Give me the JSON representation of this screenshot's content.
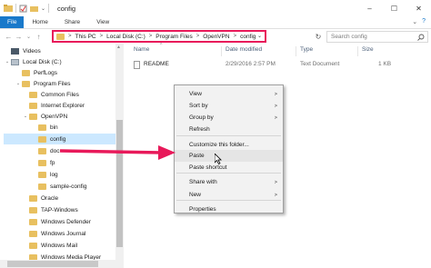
{
  "window": {
    "title": "config",
    "controls": [
      "–",
      "☐",
      "✕"
    ]
  },
  "ribbon": {
    "tabs": [
      "File",
      "Home",
      "Share",
      "View"
    ],
    "expand": "⌄",
    "help": "?"
  },
  "nav_buttons": [
    "←",
    "→",
    "⌄",
    "↑"
  ],
  "address": {
    "crumbs": [
      "This PC",
      "Local Disk (C:)",
      "Program Files",
      "OpenVPN",
      "config"
    ],
    "separator": ">",
    "dropdown": "⌄"
  },
  "search": {
    "placeholder": "Search config"
  },
  "refresh": "↻",
  "tree": [
    {
      "label": "Videos",
      "icon": "video-icon",
      "chev": ""
    },
    {
      "label": "Local Disk (C:)",
      "icon": "drive-icon",
      "chev": "⌄"
    },
    {
      "label": "PerfLogs",
      "icon": "folder-icon",
      "chev": ""
    },
    {
      "label": "Program Files",
      "icon": "folder-icon",
      "chev": "⌄"
    },
    {
      "label": "Common Files",
      "icon": "folder-icon",
      "chev": ""
    },
    {
      "label": "Internet Explorer",
      "icon": "folder-icon",
      "chev": ""
    },
    {
      "label": "OpenVPN",
      "icon": "folder-icon",
      "chev": "⌄"
    },
    {
      "label": "bin",
      "icon": "folder-icon",
      "chev": ""
    },
    {
      "label": "config",
      "icon": "folder-icon",
      "chev": "",
      "selected": true
    },
    {
      "label": "doc",
      "icon": "folder-icon",
      "chev": ""
    },
    {
      "label": "fp",
      "icon": "folder-icon",
      "chev": ""
    },
    {
      "label": "log",
      "icon": "folder-icon",
      "chev": ""
    },
    {
      "label": "sample-config",
      "icon": "folder-icon",
      "chev": ""
    },
    {
      "label": "Oracle",
      "icon": "folder-icon",
      "chev": ""
    },
    {
      "label": "TAP-Windows",
      "icon": "folder-icon",
      "chev": ""
    },
    {
      "label": "Windows Defender",
      "icon": "folder-icon",
      "chev": ""
    },
    {
      "label": "Windows Journal",
      "icon": "folder-icon",
      "chev": ""
    },
    {
      "label": "Windows Mail",
      "icon": "folder-icon",
      "chev": ""
    },
    {
      "label": "Windows Media Player",
      "icon": "folder-icon",
      "chev": ""
    }
  ],
  "columns": {
    "name": "Name",
    "date": "Date modified",
    "type": "Type",
    "size": "Size",
    "sort_arrow": "^"
  },
  "files": [
    {
      "name": "README",
      "date": "2/29/2016 2:57 PM",
      "type": "Text Document",
      "size": "1 KB"
    }
  ],
  "context_menu": {
    "items": [
      {
        "label": "View",
        "submenu": true
      },
      {
        "label": "Sort by",
        "submenu": true
      },
      {
        "label": "Group by",
        "submenu": true
      },
      {
        "label": "Refresh",
        "submenu": false
      },
      {
        "label": "Customize this folder...",
        "submenu": false
      },
      {
        "label": "Paste",
        "submenu": false,
        "highlighted": true
      },
      {
        "label": "Paste shortcut",
        "submenu": false
      },
      {
        "label": "Share with",
        "submenu": true
      },
      {
        "label": "New",
        "submenu": true
      },
      {
        "label": "Properties",
        "submenu": false
      }
    ],
    "submenu_arrow": ">"
  },
  "colors": {
    "accent": "#1979ca",
    "annotation": "#e8195a",
    "selection": "#cce8ff",
    "folder": "#e8c060"
  }
}
